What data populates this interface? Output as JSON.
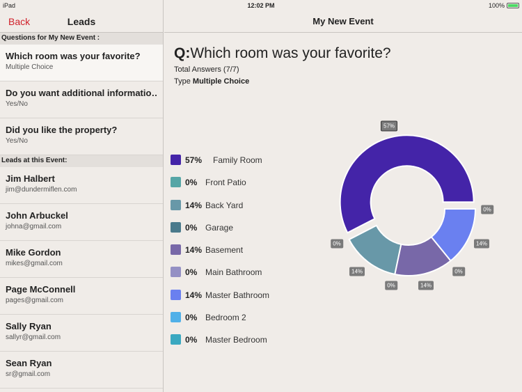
{
  "status": {
    "device": "iPad",
    "time": "12:02 PM",
    "battery": "100%",
    "battery_level": 1.0
  },
  "left": {
    "back": "Back",
    "title": "Leads",
    "questions_header": "Questions for My New Event :",
    "questions": [
      {
        "title": "Which room was your favorite?",
        "type": "Multiple Choice"
      },
      {
        "title": "Do you want additional informatio…",
        "type": "Yes/No"
      },
      {
        "title": "Did you like the property?",
        "type": "Yes/No"
      }
    ],
    "leads_header": "Leads at this Event:",
    "leads": [
      {
        "name": "Jim Halbert",
        "email": "jim@dundermiflen.com"
      },
      {
        "name": "John Arbuckel",
        "email": "johna@gmail.com"
      },
      {
        "name": "Mike Gordon",
        "email": "mikes@gmail.com"
      },
      {
        "name": "Page McConnell",
        "email": "pages@gmail.com"
      },
      {
        "name": "Sally Ryan",
        "email": "sallyr@gmail.com"
      },
      {
        "name": "Sean Ryan",
        "email": "sr@gmail.com"
      }
    ]
  },
  "main": {
    "title": "My New Event",
    "q_prefix": "Q:",
    "question": "Which room was your favorite?",
    "total_label": "Total Answers (7/7)",
    "type_label": "Type",
    "type_value": "Multiple Choice"
  },
  "chart_data": {
    "type": "pie",
    "donut": true,
    "categories": [
      "Family Room",
      "Front Patio",
      "Back Yard",
      "Garage",
      "Basement",
      "Main Bathroom",
      "Master Bathroom",
      "Bedroom 2",
      "Master Bedroom"
    ],
    "values": [
      57,
      0,
      14,
      0,
      14,
      0,
      14,
      0,
      0
    ],
    "labels": [
      "57%",
      "0%",
      "14%",
      "0%",
      "14%",
      "0%",
      "14%",
      "0%",
      "0%"
    ],
    "colors": [
      "#4424a8",
      "#56a6a6",
      "#6898a8",
      "#4a7a8c",
      "#7868a8",
      "#9490c4",
      "#6a80f0",
      "#50b0e8",
      "#3aa8c0"
    ],
    "legend": "left"
  }
}
